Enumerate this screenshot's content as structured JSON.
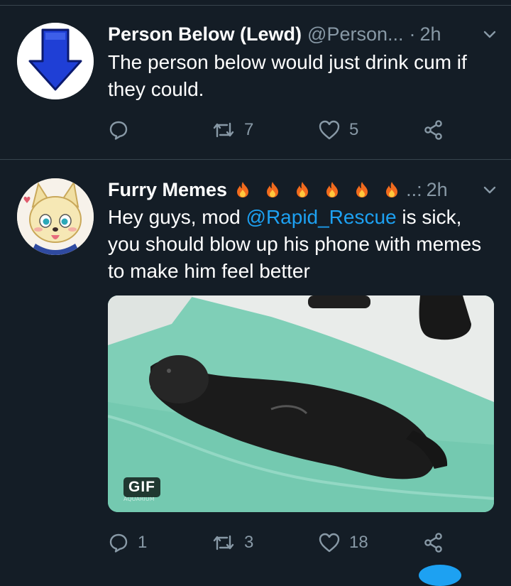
{
  "tweets": [
    {
      "name": "Person Below (Lewd)",
      "handle": "@Person...",
      "separator": "·",
      "time": "2h",
      "text": "The person below would just drink cum if they could.",
      "actions": {
        "reply": "",
        "retweet": "7",
        "like": "5"
      }
    },
    {
      "name": "Furry Memes",
      "handle_suffix": "..:",
      "time": "2h",
      "text_before": "Hey guys, mod ",
      "mention": "@Rapid_Rescue",
      "text_after": " is sick, you should blow up his phone with memes to make him feel better",
      "media_badge": "GIF",
      "actions": {
        "reply": "1",
        "retweet": "3",
        "like": "18"
      }
    }
  ],
  "colors": {
    "background": "#141d26",
    "divider": "#38444d",
    "secondary_text": "#8899a6",
    "link": "#1da1f2",
    "arrow_blue": "#1f3fd6"
  },
  "icons": [
    "down-arrow-avatar",
    "fire-icon",
    "chevron-down-icon",
    "reply-icon",
    "retweet-icon",
    "like-icon",
    "share-icon"
  ]
}
